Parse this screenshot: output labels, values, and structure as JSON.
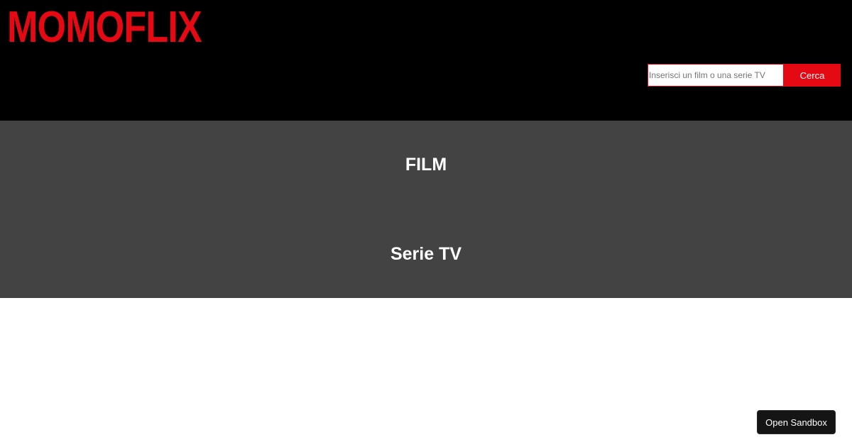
{
  "header": {
    "logo": "MOMOFLIX",
    "search": {
      "placeholder": "Inserisci un film o una serie TV",
      "value": "",
      "button_label": "Cerca"
    }
  },
  "main": {
    "sections": [
      {
        "title": "FILM"
      },
      {
        "title": "Serie TV"
      }
    ]
  },
  "sandbox": {
    "button_label": "Open Sandbox"
  },
  "colors": {
    "brand": "#e50914",
    "header_bg": "#000000",
    "main_bg": "#434343",
    "page_bg": "#ffffff"
  }
}
